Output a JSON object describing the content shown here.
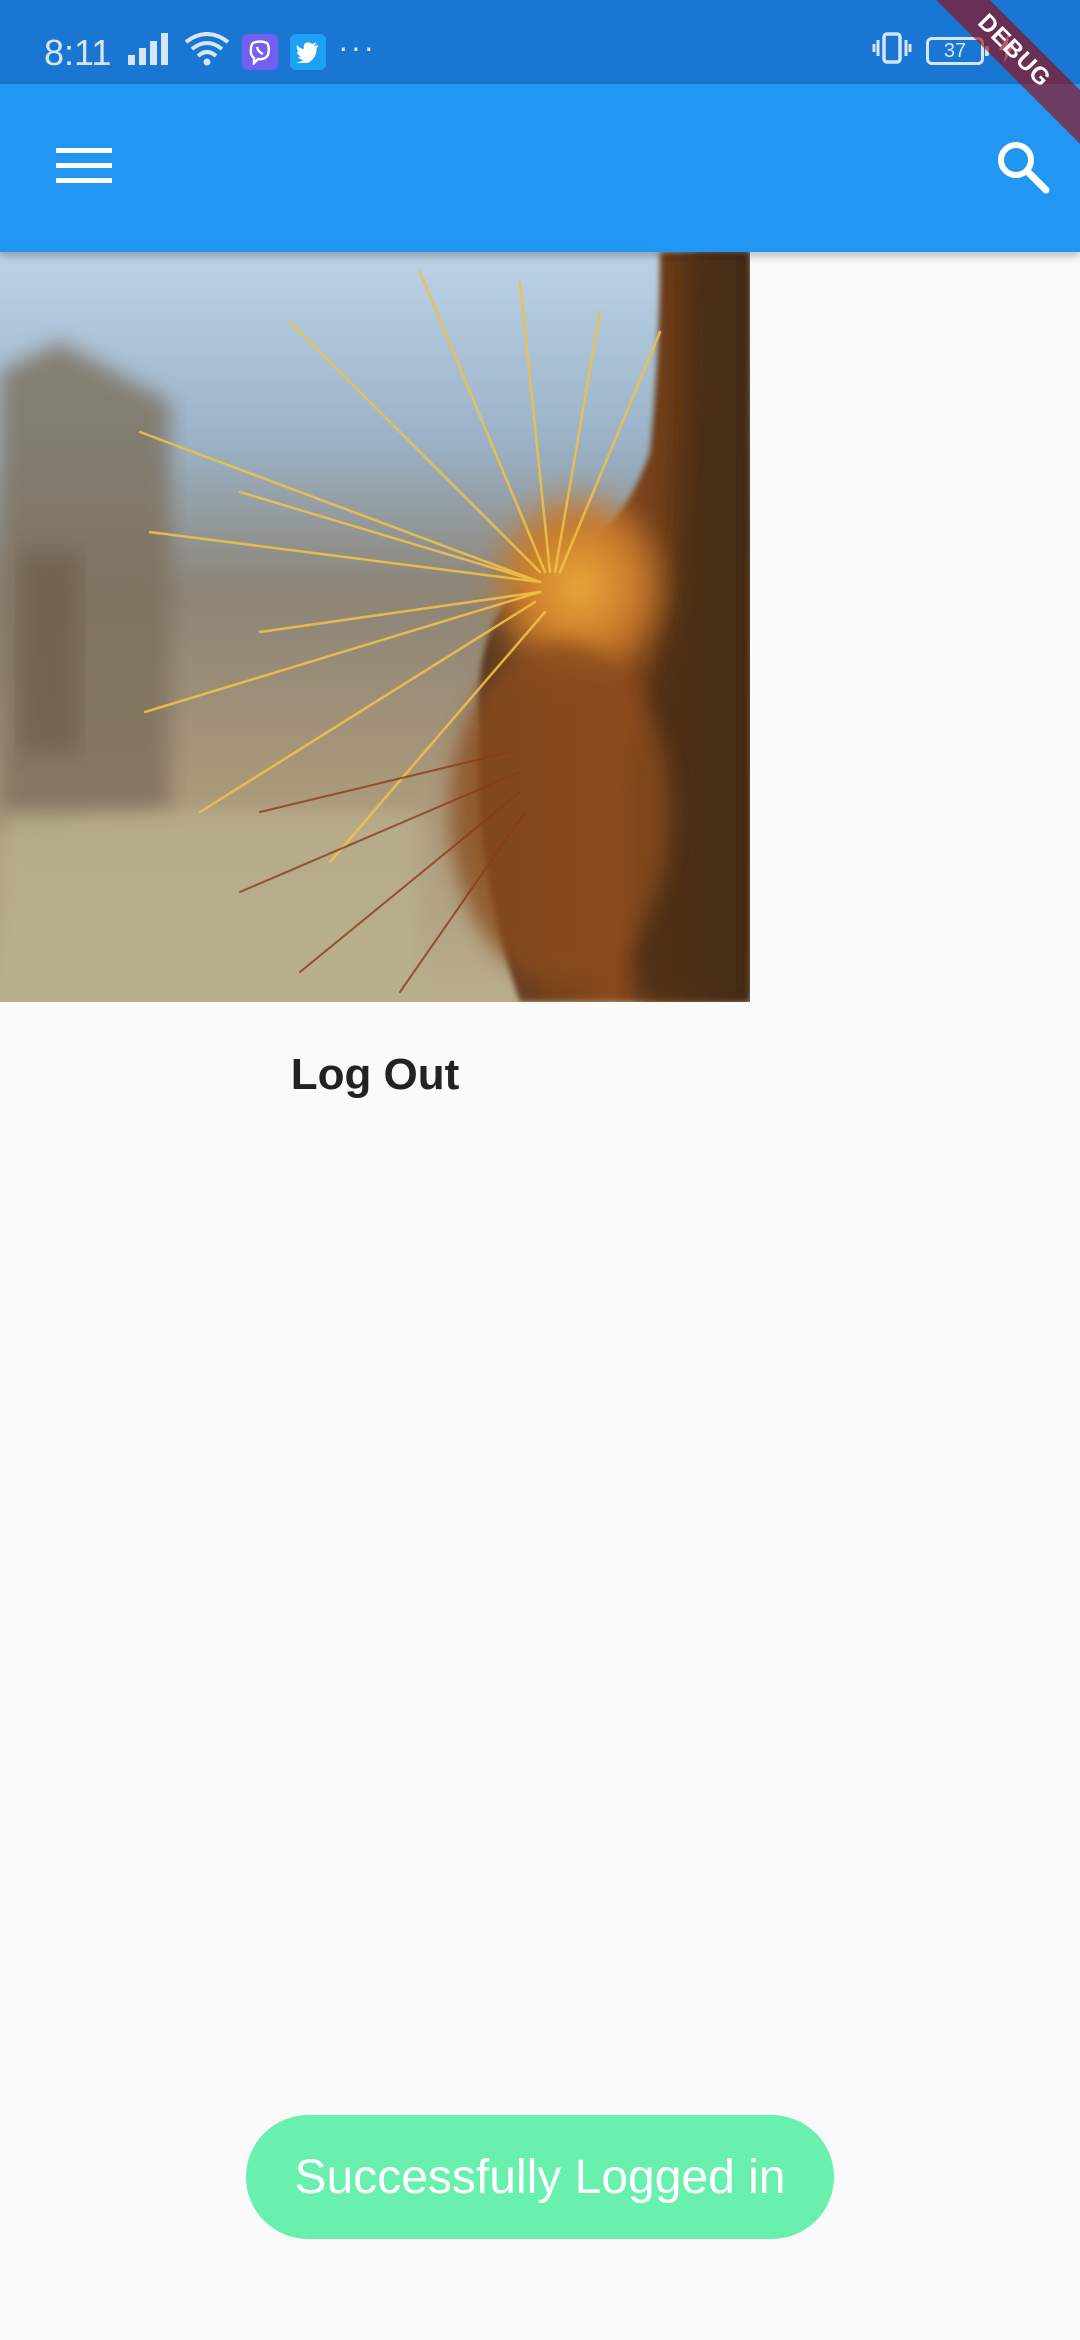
{
  "status_bar": {
    "time": "8:11",
    "more_indicator": "···",
    "battery_level": "37",
    "icons": [
      "signal-icon",
      "wifi-icon",
      "viber-icon",
      "twitter-icon",
      "vibrate-icon",
      "battery-icon",
      "charging-icon"
    ]
  },
  "debug_banner": {
    "label": "DEBUG"
  },
  "app_bar": {
    "background_color": "#2196f3",
    "menu_icon": "menu-icon",
    "search_icon": "search-icon"
  },
  "main": {
    "image_subject": "cactus-photo",
    "logout_label": "Log Out"
  },
  "toast": {
    "message": "Successfully Logged in",
    "color": "#69f0ae"
  }
}
